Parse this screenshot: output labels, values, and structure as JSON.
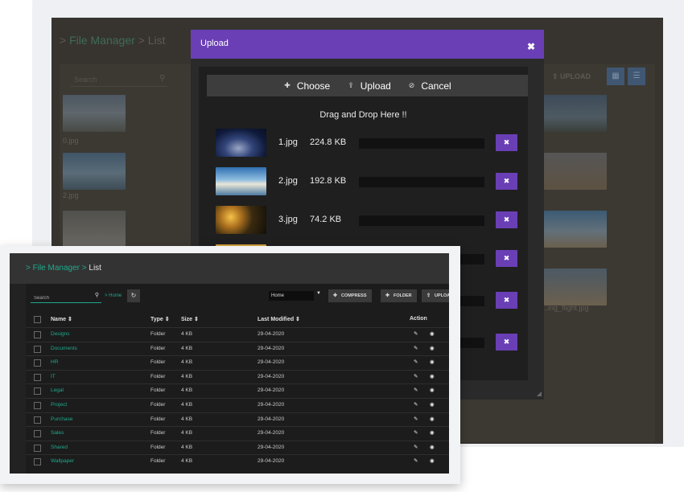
{
  "back_window": {
    "breadcrumb_sep": ">",
    "breadcrumb_link": "File Manager",
    "breadcrumb_current": "List",
    "search_placeholder": "Search",
    "upload_label": "UPLOAD",
    "items": [
      {
        "name": "0.jpg"
      },
      {
        "name": "2.jpg"
      },
      {
        "name": "..ing_flight.jpg"
      }
    ]
  },
  "upload_modal": {
    "title": "Upload",
    "close_icon": "close-icon",
    "toolbar": {
      "choose_label": "Choose",
      "upload_label": "Upload",
      "cancel_label": "Cancel"
    },
    "drop_text": "Drag and Drop Here !!",
    "files": [
      {
        "name": "1.jpg",
        "size": "224.8 KB",
        "progress": 0
      },
      {
        "name": "2.jpg",
        "size": "192.8 KB",
        "progress": 0
      },
      {
        "name": "3.jpg",
        "size": "74.2 KB",
        "progress": 0
      },
      {
        "name": "",
        "size": "",
        "progress": 0
      },
      {
        "name": "",
        "size": "",
        "progress": 0
      },
      {
        "name": "",
        "size": "",
        "progress": 0
      }
    ]
  },
  "front_window": {
    "breadcrumb_sep": ">",
    "breadcrumb_link": "File Manager",
    "breadcrumb_current": "List",
    "search_placeholder": "Search",
    "home_crumb": "> Home",
    "home_select": "Home",
    "buttons": {
      "compress": "COMPRESS",
      "folder": "FOLDER",
      "upload": "UPLOAD"
    },
    "columns": {
      "name": "Name ⇕",
      "type": "Type ⇕",
      "size": "Size ⇕",
      "modified": "Last Modified ⇕",
      "action": "Action"
    },
    "rows": [
      {
        "name": "Designs",
        "type": "Folder",
        "size": "4 KB",
        "modified": "29-04-2020"
      },
      {
        "name": "Documents",
        "type": "Folder",
        "size": "4 KB",
        "modified": "29-04-2020"
      },
      {
        "name": "HR",
        "type": "Folder",
        "size": "4 KB",
        "modified": "29-04-2020"
      },
      {
        "name": "IT",
        "type": "Folder",
        "size": "4 KB",
        "modified": "29-04-2020"
      },
      {
        "name": "Legal",
        "type": "Folder",
        "size": "4 KB",
        "modified": "29-04-2020"
      },
      {
        "name": "Project",
        "type": "Folder",
        "size": "4 KB",
        "modified": "29-04-2020"
      },
      {
        "name": "Purchase",
        "type": "Folder",
        "size": "4 KB",
        "modified": "29-04-2020"
      },
      {
        "name": "Sales",
        "type": "Folder",
        "size": "4 KB",
        "modified": "29-04-2020"
      },
      {
        "name": "Shared",
        "type": "Folder",
        "size": "4 KB",
        "modified": "29-04-2020"
      },
      {
        "name": "Wallpaper",
        "type": "Folder",
        "size": "4 KB",
        "modified": "29-04-2020"
      }
    ]
  },
  "colors": {
    "accent_purple": "#6a3fb5",
    "accent_teal": "#1fa98c",
    "panel_dark": "#1c1c1c"
  }
}
